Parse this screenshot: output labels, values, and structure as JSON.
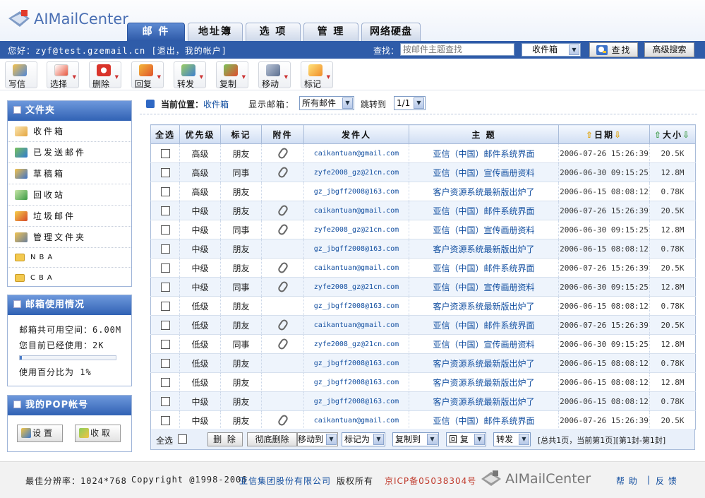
{
  "brand": {
    "name": "AIMailCenter"
  },
  "tabs": [
    {
      "label": "邮 件",
      "active": true
    },
    {
      "label": "地址簿",
      "active": false
    },
    {
      "label": "选 项",
      "active": false
    },
    {
      "label": "管 理",
      "active": false
    },
    {
      "label": "网络硬盘",
      "active": false
    }
  ],
  "userbar": {
    "greeting": "您好：zyf@test.gzemail.cn  [退出，我的帐户]",
    "find_label": "查找：",
    "search_placeholder": "按邮件主题查找",
    "folder_selected": "收件箱",
    "find_button": "查找",
    "advanced_button": "高级搜索"
  },
  "toolbar": [
    {
      "label": "写信",
      "icon": "compose-icon"
    },
    {
      "label": "选择",
      "icon": "select-icon"
    },
    {
      "label": "删除",
      "icon": "delete-icon"
    },
    {
      "label": "回复",
      "icon": "reply-icon"
    },
    {
      "label": "转发",
      "icon": "forward-icon"
    },
    {
      "label": "复制",
      "icon": "copy-icon"
    },
    {
      "label": "移动",
      "icon": "move-icon"
    },
    {
      "label": "标记",
      "icon": "mark-icon"
    }
  ],
  "sidebar": {
    "folders_title": "文件夹",
    "folders": [
      {
        "label": "收件箱",
        "icon": "inbox-icon"
      },
      {
        "label": "已发送邮件",
        "icon": "sent-icon"
      },
      {
        "label": "草稿箱",
        "icon": "drafts-icon"
      },
      {
        "label": "回收站",
        "icon": "trash-icon"
      },
      {
        "label": "垃圾邮件",
        "icon": "spam-icon"
      },
      {
        "label": "管理文件夹",
        "icon": "manage-folder-icon"
      },
      {
        "label": "NBA",
        "icon": "folder-icon"
      },
      {
        "label": "CBA",
        "icon": "folder-icon"
      }
    ],
    "usage_title": "邮箱使用情况",
    "usage_total": "邮箱共可用空间：6.00M",
    "usage_used": "您目前已经使用：2K",
    "usage_percent_text": "使用百分比为 1%",
    "usage_fraction": 0.01,
    "pop_title": "我的POP帐号",
    "pop_settings": "设置",
    "pop_receive": "收取"
  },
  "location": {
    "label": "当前位置：",
    "current": "收件箱",
    "show_label": "显示邮箱：",
    "show_selected": "所有邮件",
    "jump_label": "跳转到",
    "page_selected": "1/1"
  },
  "table": {
    "headers": {
      "select": "全选",
      "priority": "优先级",
      "tag": "标记",
      "attach": "附件",
      "sender": "发件人",
      "subject": "主 题",
      "date": "日期",
      "size": "大小"
    },
    "rows": [
      {
        "priority": "高级",
        "tag": "朋友",
        "attach": true,
        "sender": "caikantuan@gmail.com",
        "subject": "亚信（中国）邮件系统界面",
        "date": "2006-07-26 15:26:39",
        "size": "20.5K"
      },
      {
        "priority": "高级",
        "tag": "同事",
        "attach": true,
        "sender": "zyfe2008_gz@21cn.com",
        "subject": "亚信（中国）宣传画册资料",
        "date": "2006-06-30 09:15:25",
        "size": "12.8M"
      },
      {
        "priority": "高级",
        "tag": "朋友",
        "attach": false,
        "sender": "gz_jbgff2008@163.com",
        "subject": "客户资源系统最新版出炉了",
        "date": "2006-06-15 08:08:12",
        "size": "0.78K"
      },
      {
        "priority": "中级",
        "tag": "朋友",
        "attach": true,
        "sender": "caikantuan@gmail.com",
        "subject": "亚信（中国）邮件系统界面",
        "date": "2006-07-26 15:26:39",
        "size": "20.5K"
      },
      {
        "priority": "中级",
        "tag": "同事",
        "attach": true,
        "sender": "zyfe2008_gz@21cn.com",
        "subject": "亚信（中国）宣传画册资料",
        "date": "2006-06-30 09:15:25",
        "size": "12.8M"
      },
      {
        "priority": "中级",
        "tag": "朋友",
        "attach": false,
        "sender": "gz_jbgff2008@163.com",
        "subject": "客户资源系统最新版出炉了",
        "date": "2006-06-15 08:08:12",
        "size": "0.78K"
      },
      {
        "priority": "中级",
        "tag": "朋友",
        "attach": true,
        "sender": "caikantuan@gmail.com",
        "subject": "亚信（中国）邮件系统界面",
        "date": "2006-07-26 15:26:39",
        "size": "20.5K"
      },
      {
        "priority": "中级",
        "tag": "同事",
        "attach": true,
        "sender": "zyfe2008_gz@21cn.com",
        "subject": "亚信（中国）宣传画册资料",
        "date": "2006-06-30 09:15:25",
        "size": "12.8M"
      },
      {
        "priority": "低级",
        "tag": "朋友",
        "attach": false,
        "sender": "gz_jbgff2008@163.com",
        "subject": "客户资源系统最新版出炉了",
        "date": "2006-06-15 08:08:12",
        "size": "0.78K"
      },
      {
        "priority": "低级",
        "tag": "朋友",
        "attach": true,
        "sender": "caikantuan@gmail.com",
        "subject": "亚信（中国）邮件系统界面",
        "date": "2006-07-26 15:26:39",
        "size": "20.5K"
      },
      {
        "priority": "低级",
        "tag": "同事",
        "attach": true,
        "sender": "zyfe2008_gz@21cn.com",
        "subject": "亚信（中国）宣传画册资料",
        "date": "2006-06-30 09:15:25",
        "size": "12.8M"
      },
      {
        "priority": "低级",
        "tag": "朋友",
        "attach": false,
        "sender": "gz_jbgff2008@163.com",
        "subject": "客户资源系统最新版出炉了",
        "date": "2006-06-15 08:08:12",
        "size": "0.78K"
      },
      {
        "priority": "低级",
        "tag": "朋友",
        "attach": false,
        "sender": "gz_jbgff2008@163.com",
        "subject": "客户资源系统最新版出炉了",
        "date": "2006-06-15 08:08:12",
        "size": "12.8M"
      },
      {
        "priority": "中级",
        "tag": "朋友",
        "attach": false,
        "sender": "gz_jbgff2008@163.com",
        "subject": "客户资源系统最新版出炉了",
        "date": "2006-06-15 08:08:12",
        "size": "0.78K"
      },
      {
        "priority": "中级",
        "tag": "朋友",
        "attach": true,
        "sender": "caikantuan@gmail.com",
        "subject": "亚信（中国）邮件系统界面",
        "date": "2006-07-26 15:26:39",
        "size": "20.5K"
      }
    ]
  },
  "actions": {
    "select_all": "全选",
    "delete": "删 除",
    "purge": "彻底删除",
    "move_to": "移动到",
    "mark_as": "标记为",
    "copy_to": "复制到",
    "reply": "回 复",
    "forward": "转发",
    "summary": "[总共1页，当前第1页][第1封-第1封]"
  },
  "footer": {
    "resolution": "最佳分辨率：1024*768",
    "copyright": "Copyright @1998-2006",
    "company": "亚信集团股份有限公司",
    "rights": "版权所有",
    "icp": "京ICP备05038304号",
    "help": "帮 助",
    "separator": "|",
    "feedback": "反 馈"
  },
  "colors": {
    "brand_blue": "#2f5ca9",
    "link_blue": "#134fa0",
    "icp_red": "#c0392b"
  }
}
